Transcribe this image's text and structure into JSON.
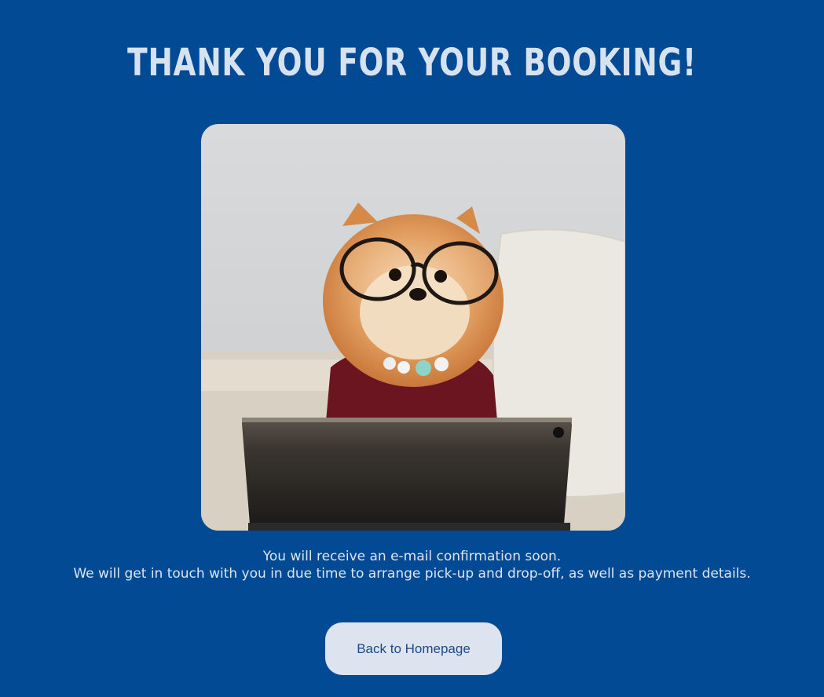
{
  "page": {
    "title": "THANK YOU FOR YOUR BOOKING!",
    "image_icon": "dog-with-glasses-photo",
    "message_line1": "You will receive an e-mail confirmation soon.",
    "message_line2": "We will get in touch with you in due time to arrange pick-up and drop-off, as well as payment details.",
    "button_label": "Back to Homepage"
  },
  "colors": {
    "background": "#024a94",
    "title": "#d7e2f1",
    "button_bg": "#dde4f0",
    "button_text": "#1c4a86"
  }
}
